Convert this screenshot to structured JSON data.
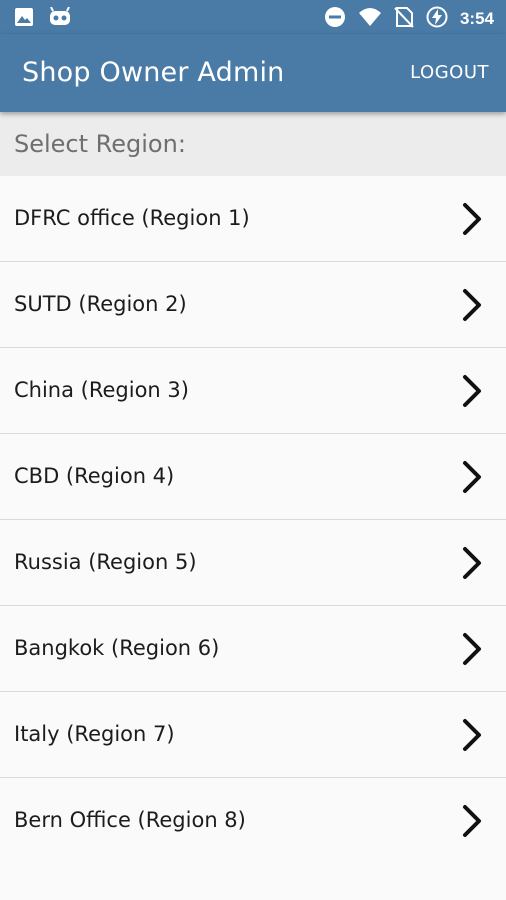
{
  "status_bar": {
    "time": "3:54",
    "left_icons": [
      "image-icon",
      "android-icon"
    ],
    "right_icons": [
      "dnd-icon",
      "wifi-icon",
      "no-sim-icon",
      "battery-charging-icon"
    ]
  },
  "app_bar": {
    "title": "Shop Owner Admin",
    "logout_label": "LOGOUT"
  },
  "section": {
    "header": "Select Region:"
  },
  "regions": [
    {
      "label": "DFRC office (Region 1)"
    },
    {
      "label": "SUTD (Region 2)"
    },
    {
      "label": "China (Region 3)"
    },
    {
      "label": "CBD (Region 4)"
    },
    {
      "label": "Russia (Region 5)"
    },
    {
      "label": "Bangkok (Region 6)"
    },
    {
      "label": "Italy (Region 7)"
    },
    {
      "label": "Bern Office (Region 8)"
    }
  ],
  "colors": {
    "primary": "#4a7ba6",
    "section_bg": "#ececec",
    "list_bg": "#fafafa"
  }
}
